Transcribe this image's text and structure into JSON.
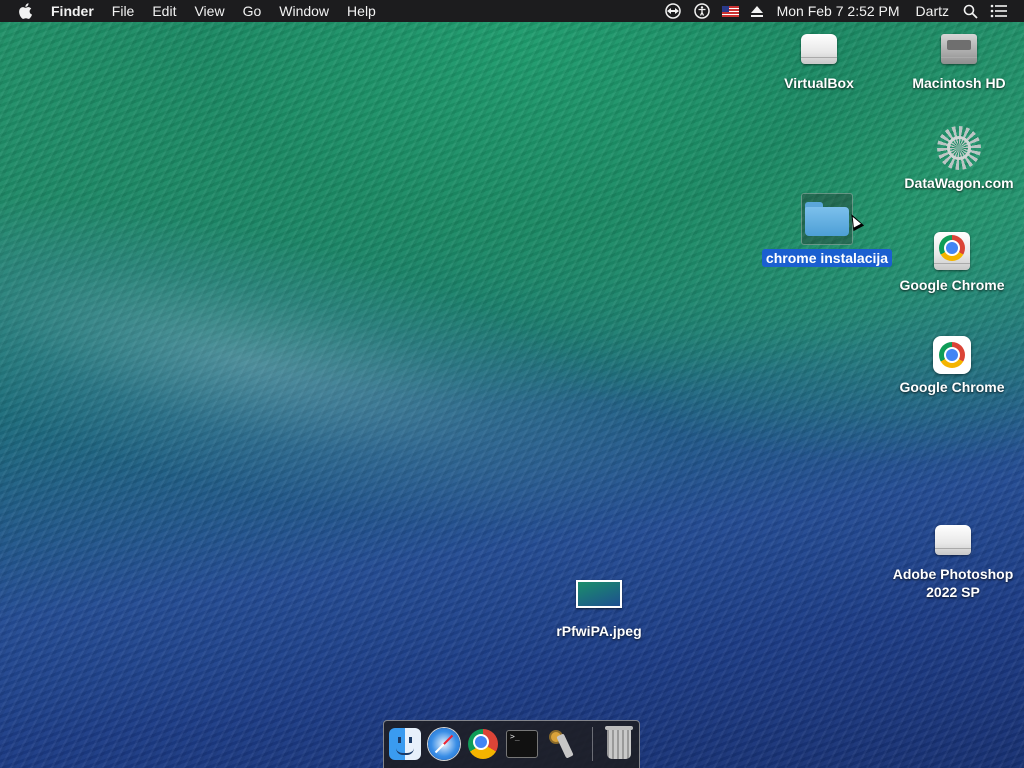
{
  "menubar": {
    "app_name": "Finder",
    "menus": [
      "File",
      "Edit",
      "View",
      "Go",
      "Window",
      "Help"
    ],
    "clock": "Mon Feb 7  2:52 PM",
    "user": "Dartz"
  },
  "desktop": {
    "icons": [
      {
        "label": "VirtualBox",
        "kind": "external-drive"
      },
      {
        "label": "Macintosh HD",
        "kind": "internal-drive"
      },
      {
        "label": "DataWagon.com",
        "kind": "app-logo"
      },
      {
        "label": "chrome instalacija",
        "kind": "folder",
        "selected": true
      },
      {
        "label": "Google Chrome",
        "kind": "disk-image"
      },
      {
        "label": "Google Chrome",
        "kind": "application"
      },
      {
        "label": "Adobe Photoshop\n2022 SP",
        "kind": "disk-image"
      },
      {
        "label": "rPfwiPA.jpeg",
        "kind": "image-file"
      }
    ]
  },
  "dock": {
    "items": [
      "Finder",
      "Safari",
      "Google Chrome",
      "Terminal",
      "Keychain Access",
      "Trash"
    ],
    "terminal_prompt": ">_"
  },
  "colors": {
    "menubar_bg": "#1c1c1e",
    "selection": "#1b5fd0"
  }
}
